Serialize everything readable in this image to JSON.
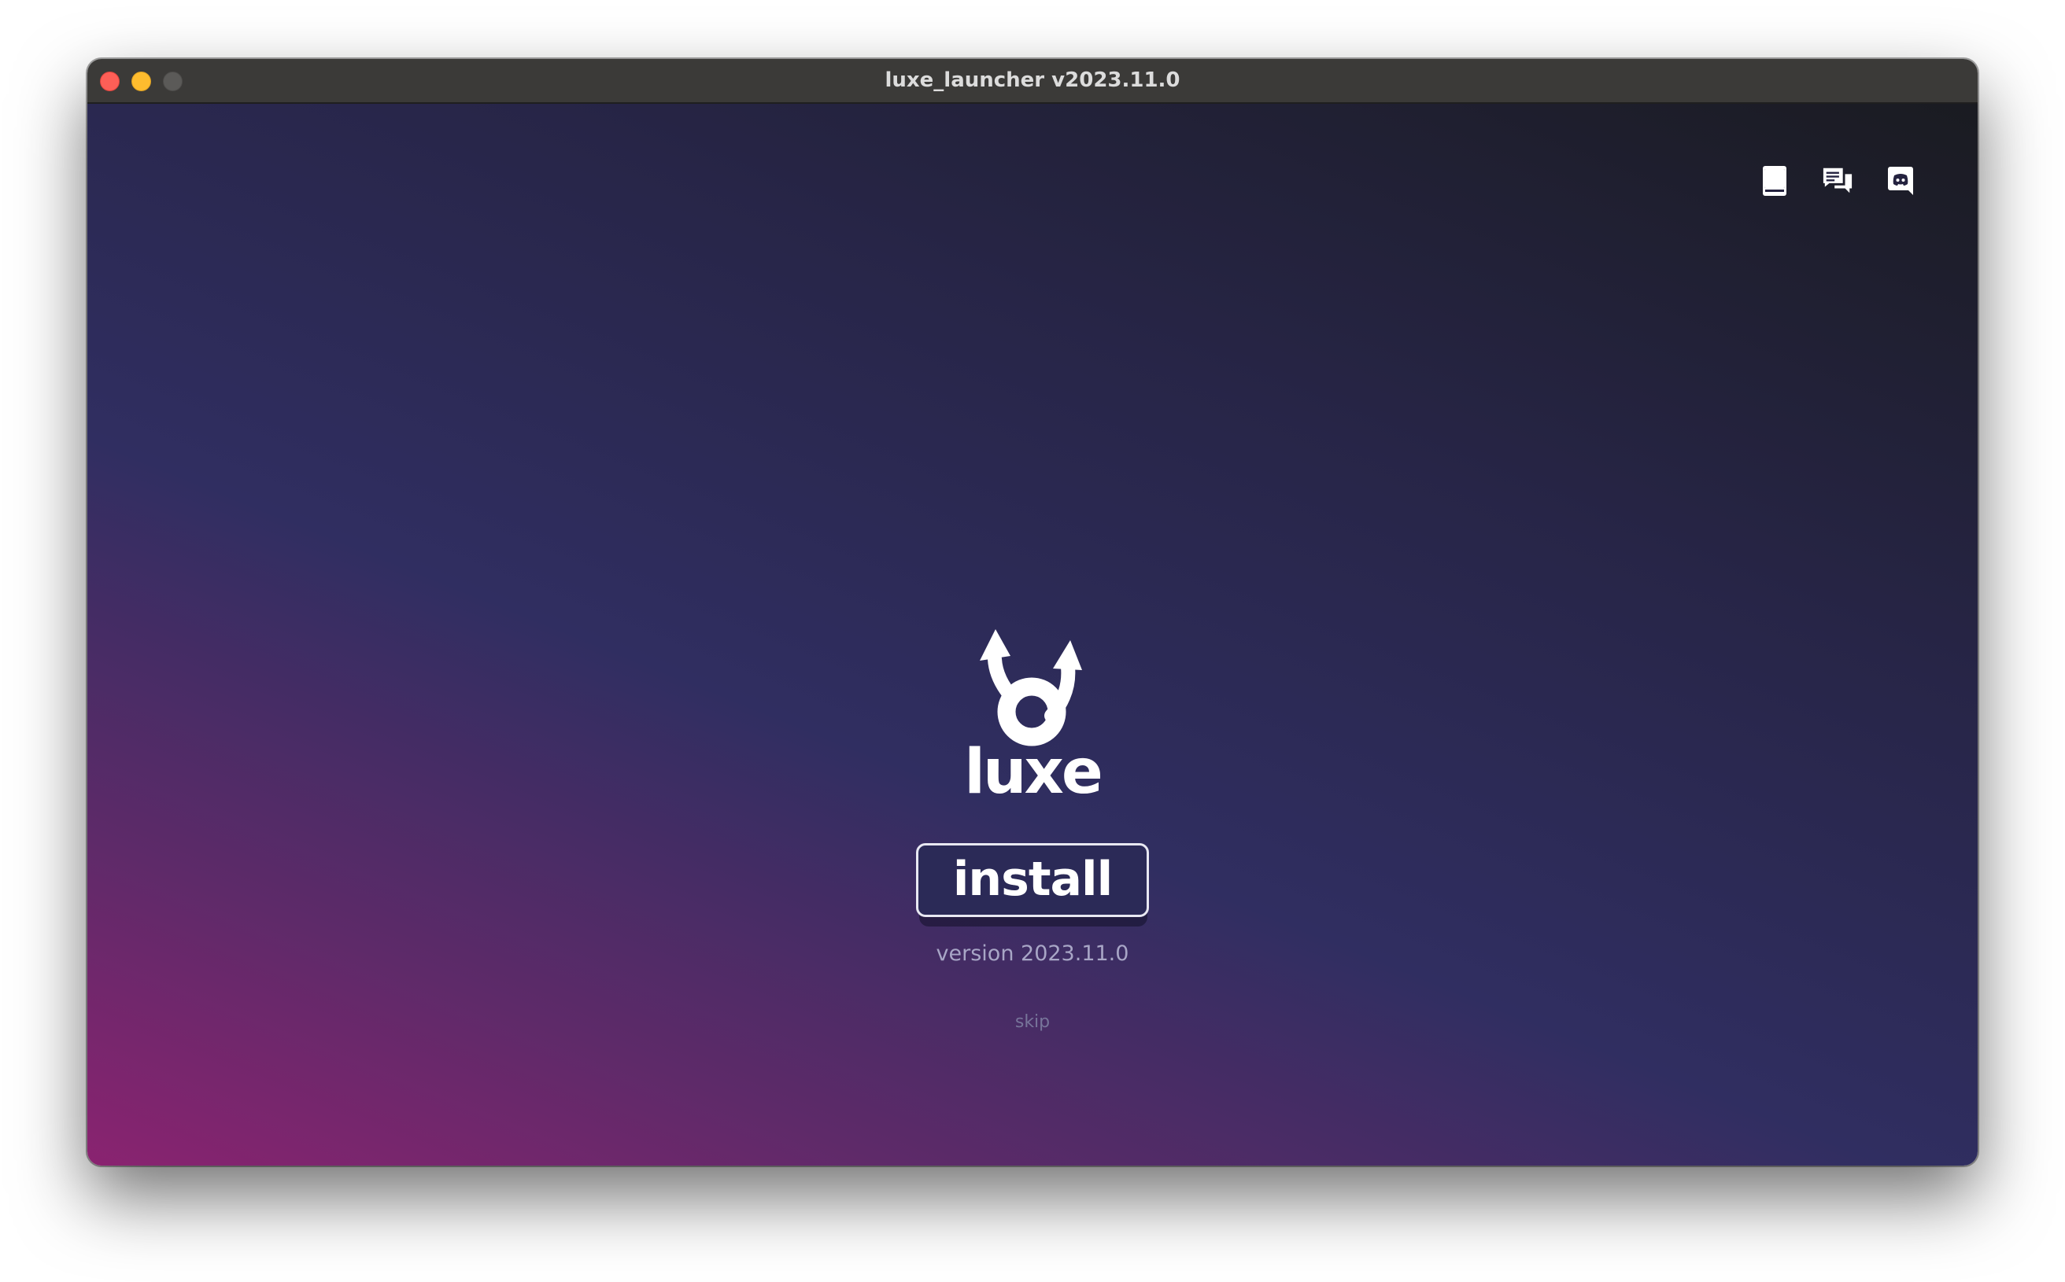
{
  "window": {
    "title": "luxe_launcher v2023.11.0"
  },
  "toolbar": {
    "icons": [
      {
        "name": "docs-book-icon",
        "color": "#ffffff"
      },
      {
        "name": "forum-chat-icon",
        "color": "#ffffff"
      },
      {
        "name": "discord-icon",
        "color": "#ffffff"
      }
    ]
  },
  "main": {
    "logo_text": "luxe",
    "install_label": "install",
    "version_text": "version 2023.11.0",
    "skip_label": "skip"
  },
  "colors": {
    "gradient_pink": "#8a2370",
    "gradient_indigo": "#302e61",
    "gradient_dark": "#1a1b21",
    "button_bg": "#2b2a57",
    "titlebar": "#3b3a38"
  }
}
